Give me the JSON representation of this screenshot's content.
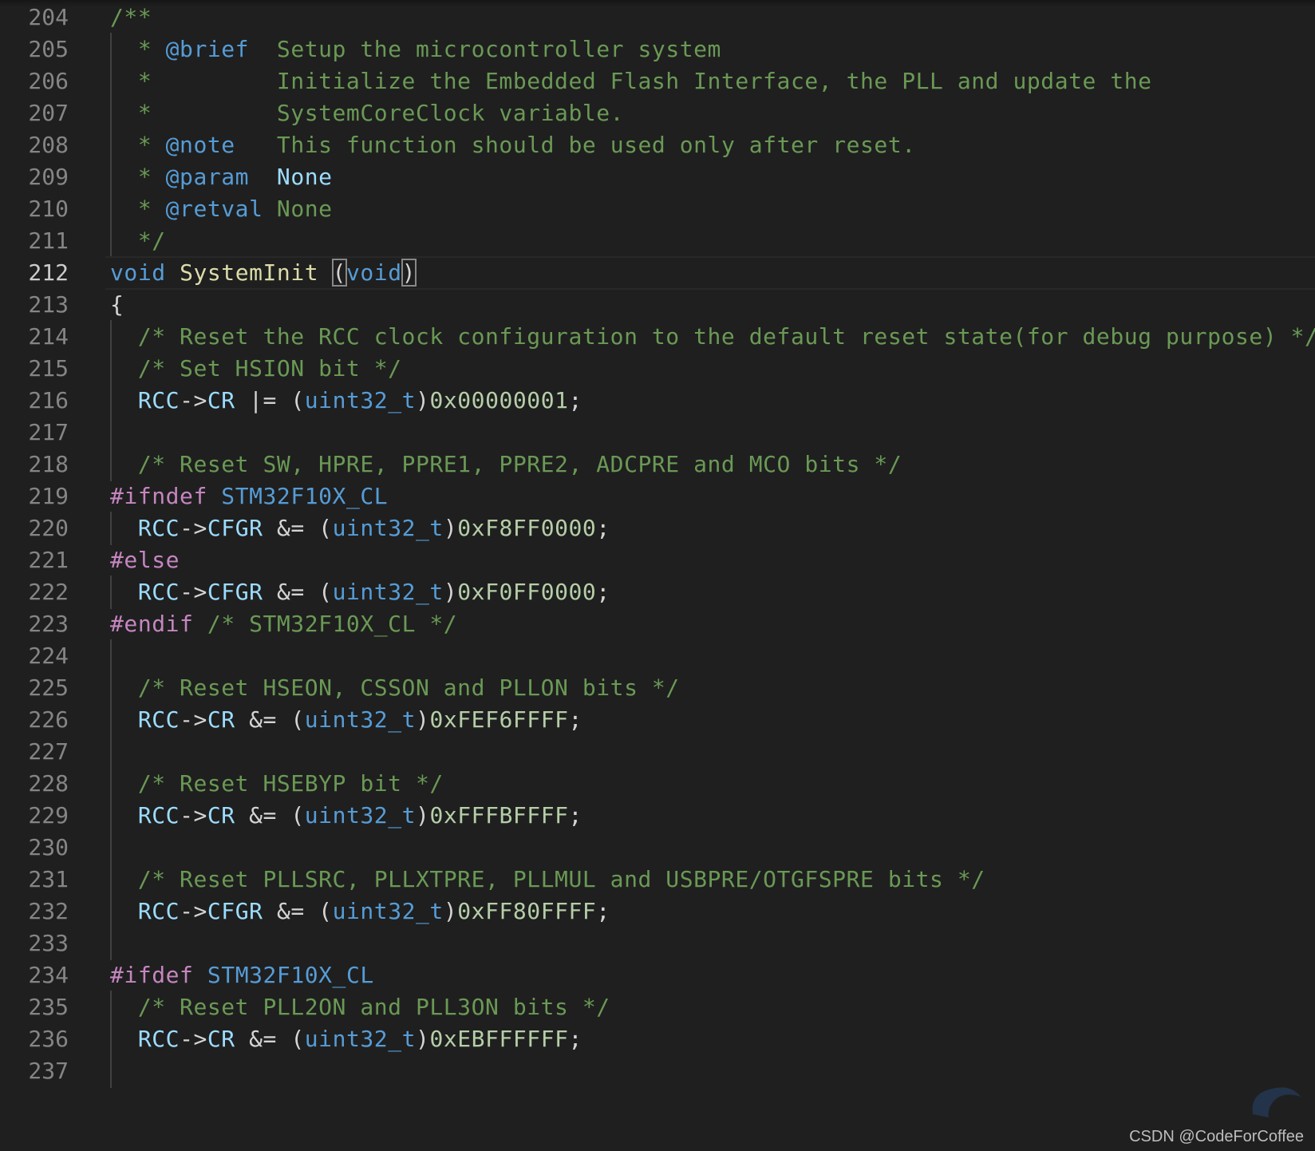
{
  "editor": {
    "active_line": "212",
    "lines": [
      {
        "n": "204",
        "tokens": [
          [
            "/**",
            "comment"
          ]
        ]
      },
      {
        "n": "205",
        "tokens": [
          [
            "  * ",
            "comment"
          ],
          [
            "@brief",
            "doctag"
          ],
          [
            "  Setup the microcontroller system",
            "comment"
          ]
        ]
      },
      {
        "n": "206",
        "tokens": [
          [
            "  *         Initialize the Embedded Flash Interface, the PLL and update the",
            "comment"
          ]
        ]
      },
      {
        "n": "207",
        "tokens": [
          [
            "  *         SystemCoreClock variable.",
            "comment"
          ]
        ]
      },
      {
        "n": "208",
        "tokens": [
          [
            "  * ",
            "comment"
          ],
          [
            "@note",
            "doctag"
          ],
          [
            "   This function should be used only after reset.",
            "comment"
          ]
        ]
      },
      {
        "n": "209",
        "tokens": [
          [
            "  * ",
            "comment"
          ],
          [
            "@param",
            "doctag"
          ],
          [
            "  ",
            "comment"
          ],
          [
            "None",
            "docval"
          ]
        ]
      },
      {
        "n": "210",
        "tokens": [
          [
            "  * ",
            "comment"
          ],
          [
            "@retval",
            "doctag"
          ],
          [
            " None",
            "comment"
          ]
        ]
      },
      {
        "n": "211",
        "tokens": [
          [
            "  */",
            "comment"
          ]
        ]
      },
      {
        "n": "212",
        "tokens": [
          [
            "void",
            "kw"
          ],
          [
            " ",
            "plain"
          ],
          [
            "SystemInit",
            "fn"
          ],
          [
            " ",
            "plain"
          ],
          [
            "(",
            "bracket"
          ],
          [
            "void",
            "kw"
          ],
          [
            ")",
            "bracket"
          ]
        ]
      },
      {
        "n": "213",
        "tokens": [
          [
            "{",
            "plain"
          ]
        ]
      },
      {
        "n": "214",
        "tokens": [
          [
            "  /* Reset the RCC clock configuration to the default reset state(for debug purpose) */",
            "comment"
          ]
        ]
      },
      {
        "n": "215",
        "tokens": [
          [
            "  /* Set HSION bit */",
            "comment"
          ]
        ]
      },
      {
        "n": "216",
        "tokens": [
          [
            "  ",
            "plain"
          ],
          [
            "RCC",
            "var"
          ],
          [
            "->",
            "plain"
          ],
          [
            "CR",
            "var"
          ],
          [
            " |= (",
            "plain"
          ],
          [
            "uint32_t",
            "type"
          ],
          [
            ")",
            "plain"
          ],
          [
            "0x00000001",
            "num"
          ],
          [
            ";",
            "plain"
          ]
        ]
      },
      {
        "n": "217",
        "tokens": []
      },
      {
        "n": "218",
        "tokens": [
          [
            "  /* Reset SW, HPRE, PPRE1, PPRE2, ADCPRE and MCO bits */",
            "comment"
          ]
        ]
      },
      {
        "n": "219",
        "tokens": [
          [
            "#ifndef",
            "pre"
          ],
          [
            " ",
            "plain"
          ],
          [
            "STM32F10X_CL",
            "macro"
          ]
        ]
      },
      {
        "n": "220",
        "tokens": [
          [
            "  ",
            "plain"
          ],
          [
            "RCC",
            "var"
          ],
          [
            "->",
            "plain"
          ],
          [
            "CFGR",
            "var"
          ],
          [
            " &= (",
            "plain"
          ],
          [
            "uint32_t",
            "type"
          ],
          [
            ")",
            "plain"
          ],
          [
            "0xF8FF0000",
            "num"
          ],
          [
            ";",
            "plain"
          ]
        ]
      },
      {
        "n": "221",
        "tokens": [
          [
            "#else",
            "pre"
          ]
        ]
      },
      {
        "n": "222",
        "tokens": [
          [
            "  ",
            "plain"
          ],
          [
            "RCC",
            "var"
          ],
          [
            "->",
            "plain"
          ],
          [
            "CFGR",
            "var"
          ],
          [
            " &= (",
            "plain"
          ],
          [
            "uint32_t",
            "type"
          ],
          [
            ")",
            "plain"
          ],
          [
            "0xF0FF0000",
            "num"
          ],
          [
            ";",
            "plain"
          ]
        ]
      },
      {
        "n": "223",
        "tokens": [
          [
            "#endif",
            "pre"
          ],
          [
            " /* STM32F10X_CL */",
            "comment"
          ]
        ]
      },
      {
        "n": "224",
        "tokens": []
      },
      {
        "n": "225",
        "tokens": [
          [
            "  /* Reset HSEON, CSSON and PLLON bits */",
            "comment"
          ]
        ]
      },
      {
        "n": "226",
        "tokens": [
          [
            "  ",
            "plain"
          ],
          [
            "RCC",
            "var"
          ],
          [
            "->",
            "plain"
          ],
          [
            "CR",
            "var"
          ],
          [
            " &= (",
            "plain"
          ],
          [
            "uint32_t",
            "type"
          ],
          [
            ")",
            "plain"
          ],
          [
            "0xFEF6FFFF",
            "num"
          ],
          [
            ";",
            "plain"
          ]
        ]
      },
      {
        "n": "227",
        "tokens": []
      },
      {
        "n": "228",
        "tokens": [
          [
            "  /* Reset HSEBYP bit */",
            "comment"
          ]
        ]
      },
      {
        "n": "229",
        "tokens": [
          [
            "  ",
            "plain"
          ],
          [
            "RCC",
            "var"
          ],
          [
            "->",
            "plain"
          ],
          [
            "CR",
            "var"
          ],
          [
            " &= (",
            "plain"
          ],
          [
            "uint32_t",
            "type"
          ],
          [
            ")",
            "plain"
          ],
          [
            "0xFFFBFFFF",
            "num"
          ],
          [
            ";",
            "plain"
          ]
        ]
      },
      {
        "n": "230",
        "tokens": []
      },
      {
        "n": "231",
        "tokens": [
          [
            "  /* Reset PLLSRC, PLLXTPRE, PLLMUL and USBPRE/OTGFSPRE bits */",
            "comment"
          ]
        ]
      },
      {
        "n": "232",
        "tokens": [
          [
            "  ",
            "plain"
          ],
          [
            "RCC",
            "var"
          ],
          [
            "->",
            "plain"
          ],
          [
            "CFGR",
            "var"
          ],
          [
            " &= (",
            "plain"
          ],
          [
            "uint32_t",
            "type"
          ],
          [
            ")",
            "plain"
          ],
          [
            "0xFF80FFFF",
            "num"
          ],
          [
            ";",
            "plain"
          ]
        ]
      },
      {
        "n": "233",
        "tokens": []
      },
      {
        "n": "234",
        "tokens": [
          [
            "#ifdef",
            "pre"
          ],
          [
            " ",
            "plain"
          ],
          [
            "STM32F10X_CL",
            "macro"
          ]
        ]
      },
      {
        "n": "235",
        "tokens": [
          [
            "  /* Reset PLL2ON and PLL3ON bits */",
            "comment"
          ]
        ]
      },
      {
        "n": "236",
        "tokens": [
          [
            "  ",
            "plain"
          ],
          [
            "RCC",
            "var"
          ],
          [
            "->",
            "plain"
          ],
          [
            "CR",
            "var"
          ],
          [
            " &= (",
            "plain"
          ],
          [
            "uint32_t",
            "type"
          ],
          [
            ")",
            "plain"
          ],
          [
            "0xEBFFFFFF",
            "num"
          ],
          [
            ";",
            "plain"
          ]
        ]
      },
      {
        "n": "237",
        "tokens": []
      }
    ]
  },
  "watermark": {
    "text": "CSDN @CodeForCoffee"
  },
  "colors": {
    "background": "#1f1f1f",
    "comment": "#6a9955",
    "keyword": "#569cd6",
    "function": "#dcdcaa",
    "variable": "#9cdcfe",
    "number": "#b5cea8",
    "preprocessor": "#c586c0",
    "line_number": "#858585",
    "line_number_active": "#cccccc"
  }
}
